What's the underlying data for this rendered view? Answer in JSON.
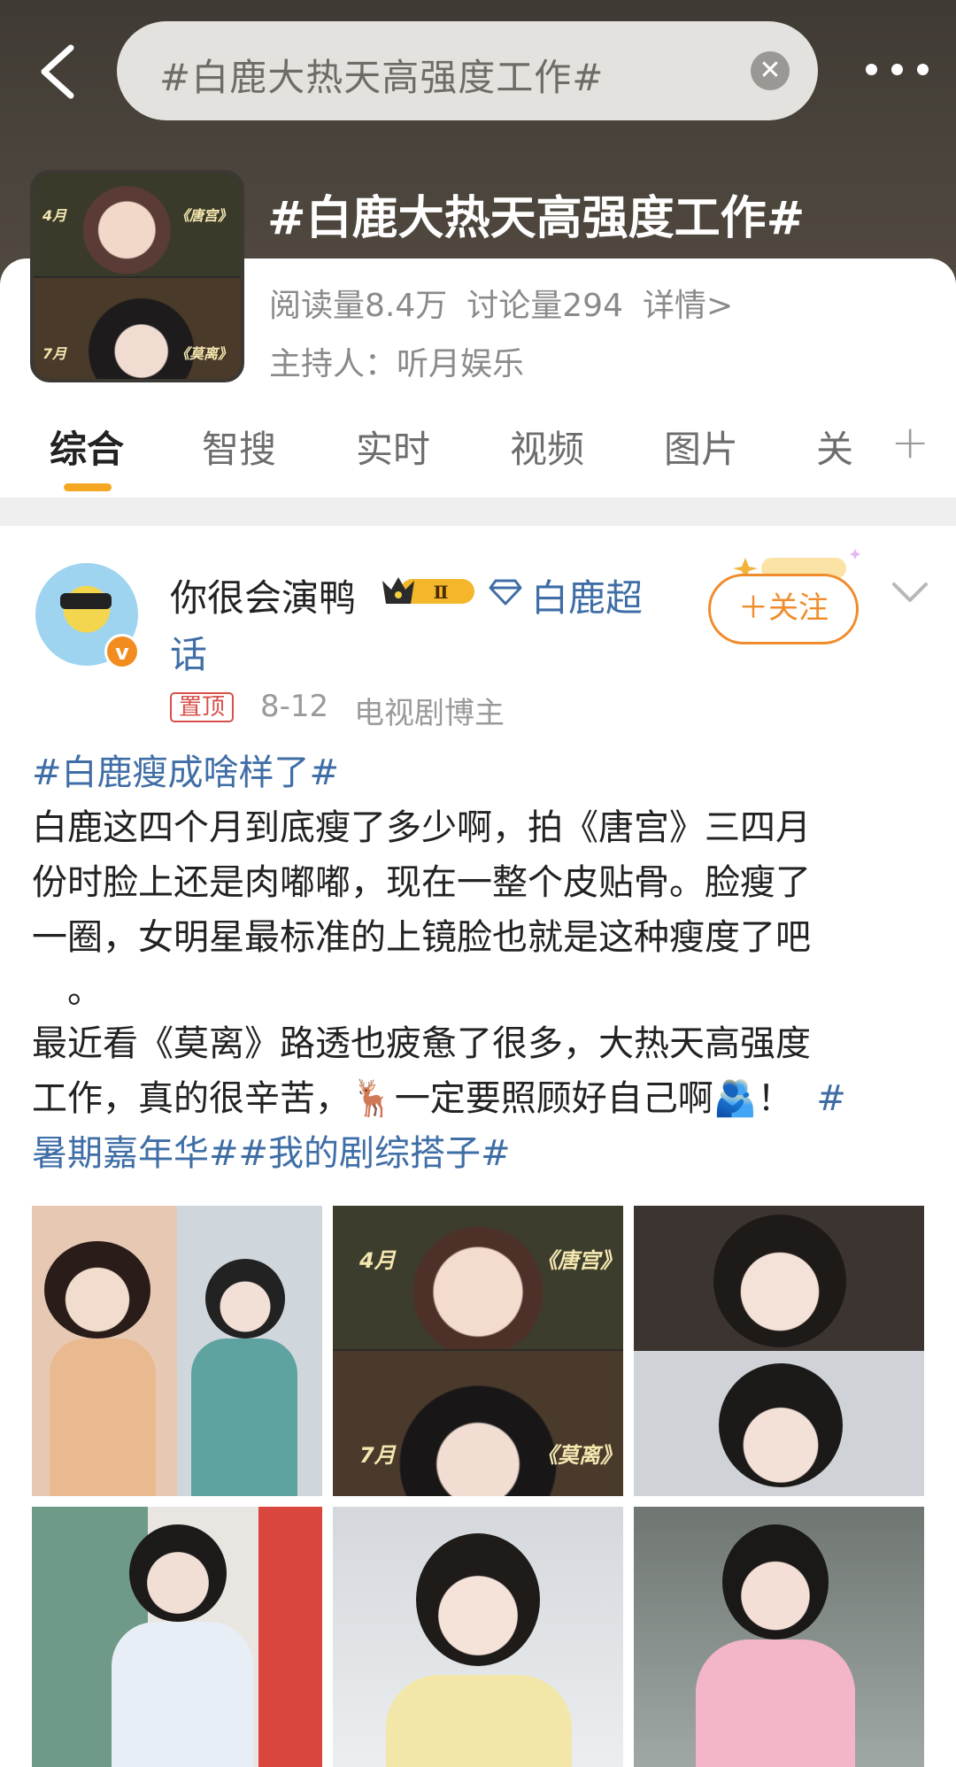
{
  "search": {
    "query": "#白鹿大热天高强度工作#"
  },
  "topic": {
    "title": "#白鹿大热天高强度工作#",
    "cover_tags": [
      "4月",
      "《唐宫》",
      "7月",
      "《莫离》"
    ],
    "reads": "阅读量8.4万",
    "discussions": "讨论量294",
    "details": "详情>",
    "host": "主持人：听月娱乐"
  },
  "tabs": [
    "综合",
    "智搜",
    "实时",
    "视频",
    "图片",
    "关"
  ],
  "tab_add": "+",
  "post": {
    "username": "你很会演鸭",
    "vip_level": "Ⅱ",
    "verified_badge": "v",
    "superchat_a": "白鹿超",
    "superchat_b": "话",
    "follow_label": "＋关注",
    "pinned": "置顶",
    "date": "8-12",
    "source": "电视剧博主",
    "hashtag1": "#白鹿瘦成啥样了#",
    "line1": "白鹿这四个月到底瘦了多少啊，拍《唐宫》三四月",
    "line2": "份时脸上还是肉嘟嘟，现在一整个皮贴骨。脸瘦了",
    "line3": "一圈，女明星最标准的上镜脸也就是这种瘦度了吧",
    "line4": "。",
    "line5": "最近看《莫离》路透也疲惫了很多，大热天高强度",
    "line6a": "工作，真的很辛苦，",
    "deer_emoji": "🦌",
    "line6b": "一定要照顾好自己啊",
    "hug_emoji": "🫂",
    "line6c": "！",
    "hashtag2a": "#",
    "hashtag2b": "暑期嘉年华##我的剧综搭子#",
    "grid_tags": [
      "4月",
      "《唐宫》",
      "7月",
      "《莫离》"
    ]
  },
  "colors": {
    "accent": "#f5a623",
    "link": "#3f6ea6",
    "follow": "#f08c2b"
  }
}
